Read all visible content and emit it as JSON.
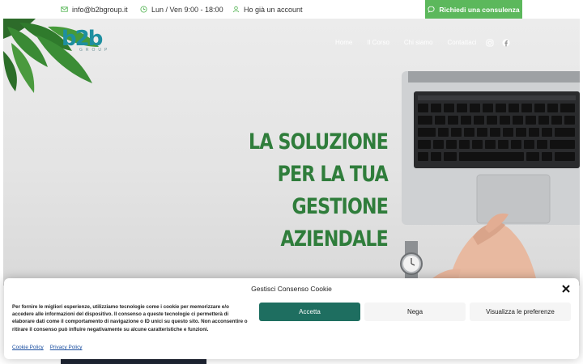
{
  "topbar": {
    "email": "info@b2bgroup.it",
    "hours": "Lun / Ven 9:00 - 18:00",
    "account": "Ho già un account",
    "cta_label": "Richiedi una consulenza"
  },
  "brand": {
    "logo_main": "b2b",
    "logo_sub": "GROUP"
  },
  "nav": {
    "items": [
      "Home",
      "Il Corso",
      "Chi siamo",
      "Contattaci"
    ]
  },
  "social": [
    "instagram-icon",
    "facebook-icon"
  ],
  "hero": {
    "line1": "LA SOLUZIONE",
    "line2": "PER LA TUA",
    "line3": "GESTIONE AZIENDALE"
  },
  "cookie": {
    "title": "Gestisci Consenso Cookie",
    "text": "Per fornire le migliori esperienze, utilizziamo tecnologie come i cookie per memorizzare e/o accedere alle informazioni del dispositivo. Il consenso a queste tecnologie ci permetterà di elaborare dati come il comportamento di navigazione o ID unici su questo sito. Non acconsentire o ritirare il consenso può influire negativamente su alcune caratteristiche e funzioni.",
    "accept": "Accetta",
    "deny": "Nega",
    "preferences": "Visualizza le preferenze",
    "cookie_policy": "Cookie Policy",
    "privacy_policy": "Privacy Policy"
  },
  "colors": {
    "accent_green": "#5cb85c",
    "headline_green": "#2f7d3b",
    "accept_button": "#1e6e60",
    "logo_teal": "#1e8fa0"
  }
}
